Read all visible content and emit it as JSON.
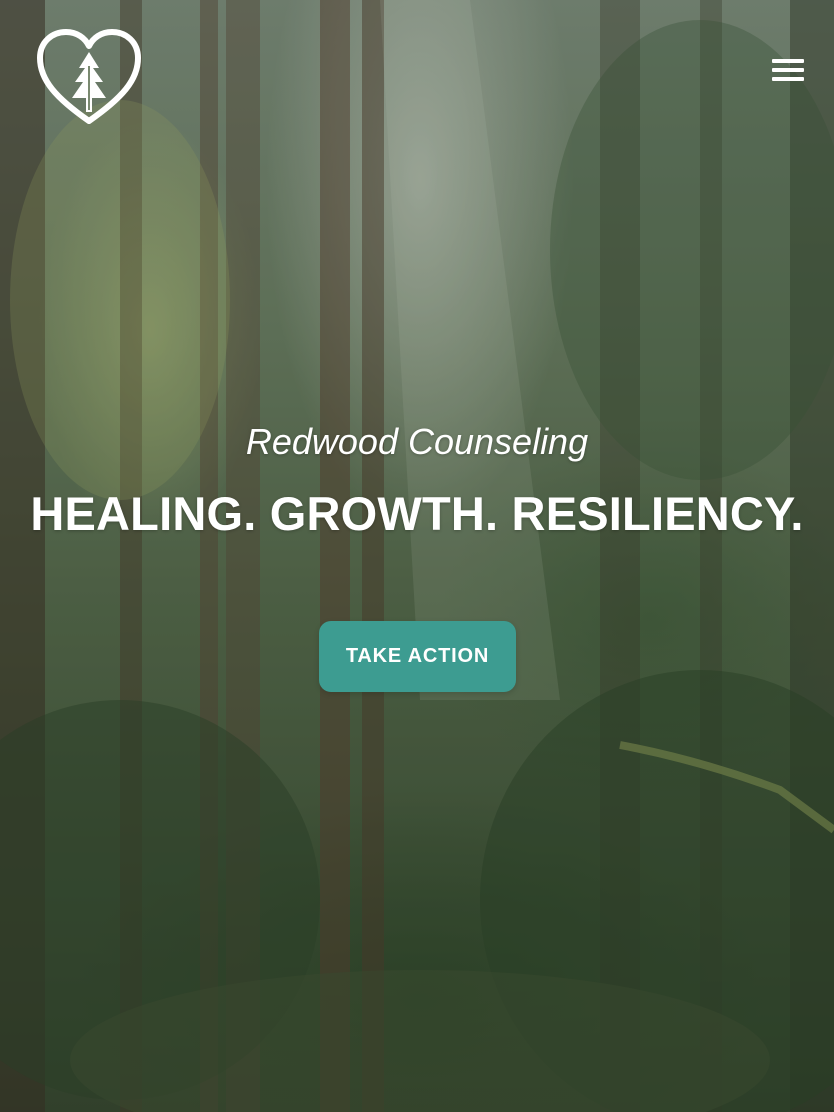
{
  "brand": {
    "name": "Redwood Counseling",
    "logo_icon": "heart-tree-icon"
  },
  "header": {
    "menu_icon": "hamburger-menu-icon"
  },
  "hero": {
    "subtitle": "Redwood Counseling",
    "headline": "HEALING. GROWTH. RESILIENCY.",
    "cta_label": "TAKE ACTION",
    "background": "forest-photo"
  },
  "colors": {
    "accent": "#3d9c91",
    "text": "#ffffff"
  }
}
